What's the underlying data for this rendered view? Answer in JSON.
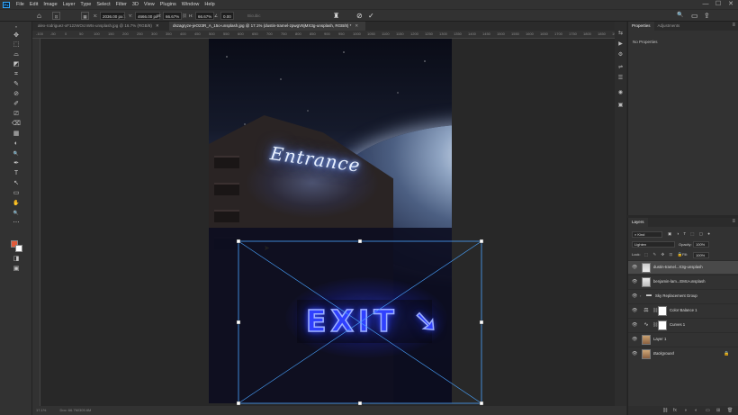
{
  "app": {
    "logo": "Ps"
  },
  "menu": [
    "File",
    "Edit",
    "Image",
    "Layer",
    "Type",
    "Select",
    "Filter",
    "3D",
    "View",
    "Plugins",
    "Window",
    "Help"
  ],
  "window_controls": {
    "minimize": "—",
    "maximize": "☐",
    "close": "✕"
  },
  "options": {
    "x_label": "X:",
    "x_value": "2036.00 px",
    "y_label": "Y:",
    "y_value": "4666.00 px",
    "w_label": "W:",
    "w_value": "66.67%",
    "h_label": "H:",
    "h_value": "66.67%",
    "angle_value": "0.00",
    "interp_label": "Bicubic",
    "cancel_icon": "⊘",
    "commit_icon": "✓",
    "search_icon": "🔍",
    "workspace_icon": "▭",
    "share_icon": "⇪"
  },
  "tabs": [
    {
      "label": "alex-rodriguez-xF12zWOcnWts-unsplash.jpg @ 16.7% (RGB/8)",
      "close": "✕"
    },
    {
      "label": "dszagryze-jeO23R_A_15o-unsplash.jpg @ 17.1% (dustin-tramel-zpwgV8jMX3g-unsplash, RGB/8) *",
      "close": "✕"
    }
  ],
  "ruler": [
    "-100",
    "-50",
    "0",
    "50",
    "100",
    "150",
    "200",
    "250",
    "300",
    "350",
    "400",
    "450",
    "500",
    "550",
    "600",
    "650",
    "700",
    "750",
    "800",
    "850",
    "900",
    "950",
    "1000",
    "1050",
    "1100",
    "1150",
    "1200",
    "1250",
    "1300",
    "1350",
    "1400",
    "1450",
    "1500",
    "1550",
    "1600",
    "1650",
    "1700",
    "1750",
    "1800",
    "1850",
    "1900"
  ],
  "tools": [
    "✥",
    "⬚",
    "⌓",
    "◩",
    "⌗",
    "✎",
    "⊘",
    "✐",
    "⎚",
    "⌫",
    "▦",
    "◐",
    "🔍",
    "✒",
    "T",
    "↖",
    "▭",
    "✋",
    "🔍",
    "⋯",
    "◨",
    "▣"
  ],
  "canvas": {
    "entrance_text": "Entrance",
    "exit_text": "EXIT ➘"
  },
  "status": {
    "zoom": "17.1%",
    "doc": "Doc: 66.7M/305.6M"
  },
  "properties": {
    "tab_properties": "Properties",
    "tab_adjustments": "Adjustments",
    "no_properties": "No Properties",
    "menu_icon": "≡"
  },
  "layers": {
    "title": "Layers",
    "filter_kind": "Kind",
    "blend_mode": "Lighten",
    "opacity_label": "Opacity:",
    "opacity_value": "100%",
    "lock_label": "Lock:",
    "fill_label": "Fill:",
    "fill_value": "100%",
    "items": [
      {
        "name": "dustin-tramel...X3g-unsplash",
        "selected": true
      },
      {
        "name": "benjamin-lam...EMU-unsplash",
        "selected": false
      },
      {
        "name": "Sky Replacement Group",
        "selected": false
      },
      {
        "name": "Color Balance 1",
        "selected": false
      },
      {
        "name": "Curves 1",
        "selected": false
      },
      {
        "name": "Layer 1",
        "selected": false
      },
      {
        "name": "Background",
        "selected": false
      }
    ],
    "footer_icons": [
      "⛓",
      "fx",
      "◑",
      "◐",
      "▭",
      "⊞",
      "🗑"
    ]
  },
  "right_strip_icons": [
    "⇆",
    "▶",
    "⚙",
    "⇌",
    "☰",
    "◉",
    "▣"
  ]
}
